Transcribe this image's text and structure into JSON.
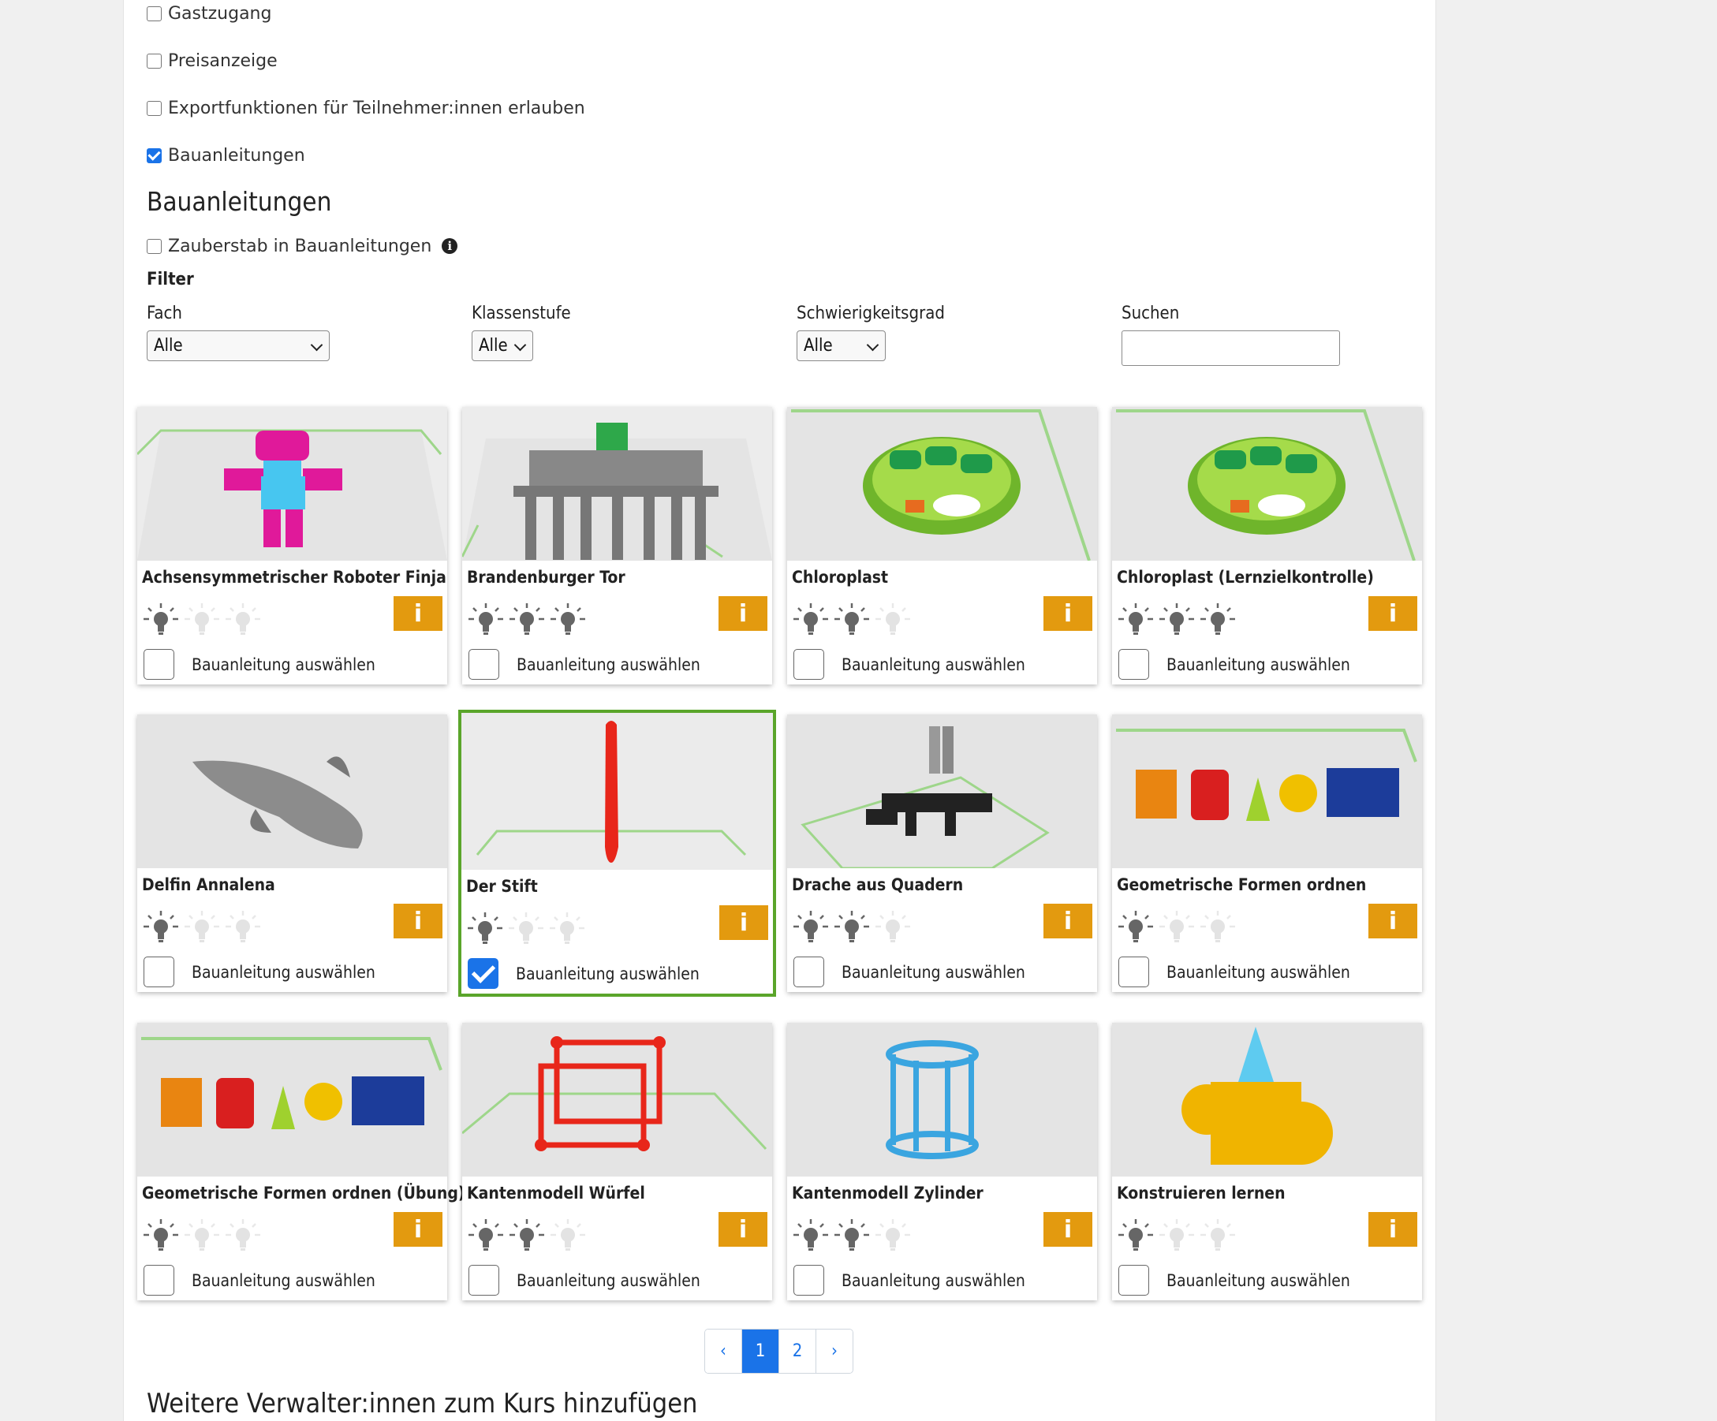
{
  "options": [
    {
      "label": "Gastzugang",
      "checked": false
    },
    {
      "label": "Preisanzeige",
      "checked": false
    },
    {
      "label": "Exportfunktionen für Teilnehmer:innen erlauben",
      "checked": false
    },
    {
      "label": "Bauanleitungen",
      "checked": true
    }
  ],
  "section_title": "Bauanleitungen",
  "zauberstab_label": "Zauberstab in Bauanleitungen",
  "info_glyph": "i",
  "filter": {
    "title": "Filter",
    "fach_label": "Fach",
    "fach_value": "Alle",
    "klasse_label": "Klassenstufe",
    "klasse_value": "Alle",
    "schwierig_label": "Schwierigkeitsgrad",
    "schwierig_value": "Alle",
    "suchen_label": "Suchen",
    "suchen_value": ""
  },
  "select_label": "Bauanleitung auswählen",
  "cards": [
    {
      "title": "Achsensymmetrischer Roboter Finja",
      "difficulty": 1,
      "selected": false
    },
    {
      "title": "Brandenburger Tor",
      "difficulty": 3,
      "selected": false
    },
    {
      "title": "Chloroplast",
      "difficulty": 2,
      "selected": false
    },
    {
      "title": "Chloroplast (Lernzielkontrolle)",
      "difficulty": 3,
      "selected": false
    },
    {
      "title": "Delfin Annalena",
      "difficulty": 1,
      "selected": false
    },
    {
      "title": "Der Stift",
      "difficulty": 1,
      "selected": true
    },
    {
      "title": "Drache aus Quadern",
      "difficulty": 2,
      "selected": false
    },
    {
      "title": "Geometrische Formen ordnen",
      "difficulty": 1,
      "selected": false
    },
    {
      "title": "Geometrische Formen ordnen (Übung)",
      "difficulty": 1,
      "selected": false
    },
    {
      "title": "Kantenmodell Würfel",
      "difficulty": 2,
      "selected": false
    },
    {
      "title": "Kantenmodell Zylinder",
      "difficulty": 2,
      "selected": false
    },
    {
      "title": "Konstruieren lernen",
      "difficulty": 1,
      "selected": false
    }
  ],
  "pagination": {
    "prev": "‹",
    "pages": [
      "1",
      "2"
    ],
    "current": "1",
    "next": "›"
  },
  "weitere_title": "Weitere Verwalter:innen zum Kurs hinzufügen",
  "colors": {
    "accent": "#1a73e8",
    "info_button": "#e39a0f",
    "selected_border": "#5aa52a"
  }
}
